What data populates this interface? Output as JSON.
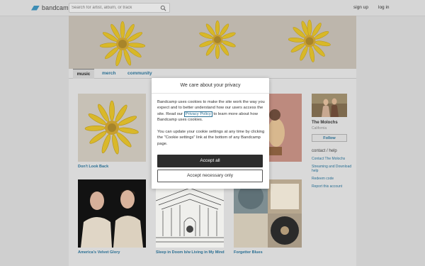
{
  "header": {
    "logo_text": "bandcamp",
    "search_placeholder": "Search for artist, album, or track",
    "signup_label": "sign up",
    "login_label": "log in"
  },
  "tabs": [
    {
      "label": "music",
      "active": true
    },
    {
      "label": "merch",
      "active": false
    },
    {
      "label": "community",
      "active": false
    }
  ],
  "albums": [
    {
      "title": "Don't Look Back"
    },
    {
      "title": ""
    },
    {
      "title": ""
    },
    {
      "title": "America's Velvet Glory"
    },
    {
      "title": "Sleep in Doom b/w Living in My Mind"
    },
    {
      "title": "Forgetter Blues"
    }
  ],
  "sidebar": {
    "band_name": "The Molochs",
    "location": "California",
    "follow_label": "Follow",
    "contact_heading": "contact / help",
    "links": [
      "Contact The Molochs",
      "Streaming and Download help",
      "Redeem code",
      "Report this account"
    ]
  },
  "cookie_modal": {
    "title": "We care about your privacy",
    "paragraph1_before": "Bandcamp uses cookies to make the site work the way you expect and to better understand how our users access the site. Read our ",
    "policy_link": "Privacy Policy",
    "paragraph1_after": " to learn more about how Bandcamp uses cookies.",
    "paragraph2": "You can update your cookie settings at any time by clicking the \"Cookie settings\" link at the bottom of any Bandcamp page.",
    "accept_all_label": "Accept all",
    "accept_necessary_label": "Accept necessary only"
  },
  "colors": {
    "link": "#2a6f93",
    "logo": "#3d8db5",
    "primary_button": "#2d2d2d"
  }
}
